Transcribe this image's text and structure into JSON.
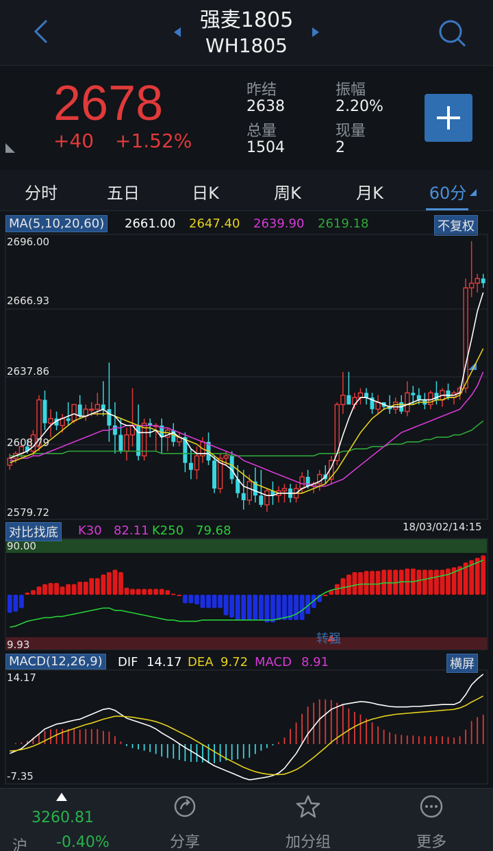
{
  "header": {
    "name": "强麦1805",
    "code": "WH1805"
  },
  "quote": {
    "price": "2678",
    "change": "+40",
    "change_pct": "+1.52%",
    "stats": [
      {
        "label": "昨结",
        "value": "2638"
      },
      {
        "label": "振幅",
        "value": "2.20%"
      },
      {
        "label": "总量",
        "value": "1504"
      },
      {
        "label": "现量",
        "value": "2"
      }
    ]
  },
  "tabs": [
    {
      "label": "分时"
    },
    {
      "label": "五日"
    },
    {
      "label": "日K"
    },
    {
      "label": "周K"
    },
    {
      "label": "月K"
    },
    {
      "label": "60分"
    }
  ],
  "ma": {
    "label": "MA(5,10,20,60)",
    "v5": "2661.00",
    "v10": "2647.40",
    "v20": "2639.90",
    "v60": "2619.18",
    "adjust": "不复权"
  },
  "k_axis": {
    "ticks": [
      "2696.00",
      "2666.93",
      "2637.86",
      "2608.79",
      "2579.72"
    ]
  },
  "bottom_ind": {
    "label": "对比找底",
    "k30_label": "K30",
    "k30": "82.11",
    "k250_label": "K250",
    "k250": "79.68",
    "datetime": "18/03/02/14:15",
    "top": "90.00",
    "bottom": "9.93",
    "annot": "转强"
  },
  "macd": {
    "label": "MACD(12,26,9)",
    "dif_label": "DIF",
    "dif": "14.17",
    "dea_label": "DEA",
    "dea": "9.72",
    "macd_label": "MACD",
    "macd": "8.91",
    "landscape": "横屏",
    "max": "14.17",
    "min": "-7.35"
  },
  "bottom_bar": {
    "index_value": "3260.81",
    "index_name": "沪",
    "index_pct": "-0.40%",
    "share": "分享",
    "watch": "加分组",
    "more": "更多"
  },
  "colors": {
    "up": "#e03a3a",
    "down": "#3ad6e0",
    "ma5": "#ffffff",
    "ma10": "#e6d21e",
    "ma20": "#d63ad6",
    "ma60": "#2fa83a",
    "accent": "#4a90d9"
  },
  "chart_data": [
    {
      "type": "candlestick",
      "ylim": [
        2579.72,
        2696.0
      ],
      "candles": [
        [
          2600,
          2605,
          2598,
          2603
        ],
        [
          2603,
          2606,
          2601,
          2605
        ],
        [
          2605,
          2609,
          2603,
          2608
        ],
        [
          2608,
          2611,
          2605,
          2606
        ],
        [
          2606,
          2615,
          2604,
          2613
        ],
        [
          2608,
          2630,
          2606,
          2628
        ],
        [
          2628,
          2632,
          2615,
          2618
        ],
        [
          2618,
          2624,
          2612,
          2620
        ],
        [
          2620,
          2623,
          2615,
          2617
        ],
        [
          2617,
          2622,
          2614,
          2620
        ],
        [
          2620,
          2627,
          2617,
          2619
        ],
        [
          2619,
          2626,
          2618,
          2626
        ],
        [
          2626,
          2630,
          2620,
          2621
        ],
        [
          2621,
          2626,
          2619,
          2624
        ],
        [
          2624,
          2627,
          2621,
          2624
        ],
        [
          2624,
          2631,
          2621,
          2626
        ],
        [
          2626,
          2636,
          2621,
          2624
        ],
        [
          2624,
          2644,
          2610,
          2617
        ],
        [
          2617,
          2627,
          2605,
          2613
        ],
        [
          2613,
          2620,
          2605,
          2606
        ],
        [
          2606,
          2616,
          2602,
          2613
        ],
        [
          2613,
          2633,
          2608,
          2617
        ],
        [
          2617,
          2626,
          2602,
          2604
        ],
        [
          2604,
          2620,
          2602,
          2618
        ],
        [
          2618,
          2620,
          2612,
          2617
        ],
        [
          2617,
          2618,
          2606,
          2617
        ],
        [
          2617,
          2620,
          2605,
          2612
        ],
        [
          2612,
          2616,
          2606,
          2615
        ],
        [
          2615,
          2618,
          2608,
          2610
        ],
        [
          2610,
          2614,
          2608,
          2612
        ],
        [
          2612,
          2614,
          2597,
          2601
        ],
        [
          2601,
          2607,
          2594,
          2598
        ],
        [
          2598,
          2608,
          2594,
          2604
        ],
        [
          2604,
          2612,
          2601,
          2610
        ],
        [
          2610,
          2614,
          2600,
          2602
        ],
        [
          2602,
          2604,
          2588,
          2590
        ],
        [
          2590,
          2605,
          2588,
          2603
        ],
        [
          2603,
          2606,
          2600,
          2604
        ],
        [
          2604,
          2606,
          2592,
          2594
        ],
        [
          2594,
          2600,
          2586,
          2588
        ],
        [
          2588,
          2598,
          2581,
          2585
        ],
        [
          2585,
          2596,
          2583,
          2593
        ],
        [
          2593,
          2599,
          2584,
          2587
        ],
        [
          2587,
          2598,
          2582,
          2583
        ],
        [
          2583,
          2590,
          2580,
          2589
        ],
        [
          2589,
          2593,
          2583,
          2587
        ],
        [
          2587,
          2591,
          2584,
          2589
        ],
        [
          2589,
          2592,
          2584,
          2590
        ],
        [
          2590,
          2592,
          2584,
          2586
        ],
        [
          2586,
          2592,
          2584,
          2590
        ],
        [
          2590,
          2597,
          2588,
          2595
        ],
        [
          2595,
          2598,
          2590,
          2591
        ],
        [
          2591,
          2593,
          2588,
          2592
        ],
        [
          2592,
          2598,
          2589,
          2596
        ],
        [
          2596,
          2600,
          2592,
          2594
        ],
        [
          2594,
          2604,
          2592,
          2602
        ],
        [
          2602,
          2627,
          2600,
          2626
        ],
        [
          2626,
          2640,
          2622,
          2630
        ],
        [
          2630,
          2640,
          2628,
          2626
        ],
        [
          2626,
          2631,
          2624,
          2629
        ],
        [
          2629,
          2633,
          2626,
          2631
        ],
        [
          2631,
          2633,
          2626,
          2629
        ],
        [
          2629,
          2631,
          2622,
          2624
        ],
        [
          2624,
          2630,
          2622,
          2627
        ],
        [
          2627,
          2627,
          2624,
          2625
        ],
        [
          2625,
          2630,
          2622,
          2624
        ],
        [
          2624,
          2629,
          2622,
          2627
        ],
        [
          2627,
          2630,
          2622,
          2623
        ],
        [
          2623,
          2636,
          2621,
          2631
        ],
        [
          2631,
          2634,
          2626,
          2630
        ],
        [
          2630,
          2633,
          2626,
          2628
        ],
        [
          2628,
          2631,
          2624,
          2626
        ],
        [
          2626,
          2632,
          2624,
          2631
        ],
        [
          2631,
          2636,
          2626,
          2628
        ],
        [
          2628,
          2633,
          2625,
          2632
        ],
        [
          2632,
          2635,
          2628,
          2629
        ],
        [
          2629,
          2632,
          2626,
          2631
        ],
        [
          2631,
          2634,
          2628,
          2633
        ],
        [
          2633,
          2680,
          2631,
          2676
        ],
        [
          2676,
          2696,
          2672,
          2678
        ],
        [
          2678,
          2682,
          2674,
          2680
        ],
        [
          2680,
          2682,
          2676,
          2678
        ]
      ],
      "ma5": [
        2603,
        2604,
        2605,
        2606,
        2608,
        2611,
        2614,
        2617,
        2619,
        2620,
        2621,
        2622,
        2621,
        2621,
        2622,
        2623,
        2624,
        2622,
        2621,
        2618,
        2617,
        2617,
        2614,
        2614,
        2614,
        2615,
        2612,
        2613,
        2614,
        2612,
        2611,
        2607,
        2605,
        2605,
        2605,
        2603,
        2601,
        2600,
        2598,
        2594,
        2591,
        2590,
        2589,
        2588,
        2587,
        2587,
        2588,
        2588,
        2588,
        2588,
        2590,
        2591,
        2592,
        2593,
        2595,
        2599,
        2605,
        2613,
        2620,
        2626,
        2629,
        2629,
        2628,
        2627,
        2626,
        2625,
        2625,
        2625,
        2626,
        2627,
        2628,
        2628,
        2628,
        2629,
        2630,
        2630,
        2630,
        2631,
        2643,
        2654,
        2666,
        2674
      ],
      "ma10": [
        2601,
        2602,
        2603,
        2604,
        2605,
        2607,
        2609,
        2611,
        2613,
        2615,
        2617,
        2619,
        2620,
        2621,
        2622,
        2622,
        2622,
        2622,
        2621,
        2620,
        2619,
        2618,
        2617,
        2616,
        2616,
        2615,
        2614,
        2614,
        2613,
        2612,
        2611,
        2610,
        2609,
        2607,
        2606,
        2604,
        2602,
        2601,
        2600,
        2598,
        2596,
        2594,
        2592,
        2591,
        2590,
        2589,
        2588,
        2588,
        2588,
        2588,
        2588,
        2589,
        2590,
        2591,
        2592,
        2595,
        2598,
        2602,
        2606,
        2610,
        2614,
        2617,
        2620,
        2622,
        2624,
        2625,
        2626,
        2626,
        2626,
        2626,
        2627,
        2627,
        2627,
        2628,
        2628,
        2629,
        2629,
        2630,
        2635,
        2640,
        2645,
        2650
      ],
      "ma20": [
        2602,
        2602,
        2603,
        2603,
        2604,
        2604,
        2605,
        2606,
        2607,
        2608,
        2609,
        2610,
        2611,
        2612,
        2613,
        2614,
        2615,
        2615,
        2616,
        2616,
        2617,
        2617,
        2617,
        2617,
        2617,
        2617,
        2616,
        2616,
        2615,
        2614,
        2613,
        2612,
        2611,
        2610,
        2609,
        2608,
        2607,
        2606,
        2605,
        2604,
        2602,
        2601,
        2600,
        2599,
        2598,
        2597,
        2596,
        2595,
        2594,
        2593,
        2592,
        2592,
        2591,
        2591,
        2591,
        2592,
        2593,
        2594,
        2596,
        2598,
        2600,
        2602,
        2604,
        2606,
        2608,
        2610,
        2612,
        2614,
        2615,
        2616,
        2617,
        2618,
        2619,
        2620,
        2621,
        2622,
        2623,
        2624,
        2627,
        2630,
        2634,
        2640
      ],
      "ma60": [
        2604,
        2604,
        2604,
        2604,
        2605,
        2605,
        2605,
        2605,
        2605,
        2605,
        2606,
        2606,
        2606,
        2606,
        2606,
        2606,
        2606,
        2606,
        2606,
        2606,
        2606,
        2606,
        2606,
        2606,
        2606,
        2606,
        2605,
        2605,
        2605,
        2605,
        2605,
        2605,
        2605,
        2605,
        2605,
        2605,
        2605,
        2605,
        2604,
        2604,
        2604,
        2604,
        2604,
        2604,
        2604,
        2604,
        2604,
        2604,
        2604,
        2604,
        2604,
        2604,
        2604,
        2605,
        2605,
        2605,
        2605,
        2606,
        2606,
        2607,
        2607,
        2607,
        2608,
        2608,
        2608,
        2609,
        2609,
        2609,
        2610,
        2610,
        2610,
        2611,
        2611,
        2612,
        2612,
        2612,
        2613,
        2613,
        2614,
        2615,
        2617,
        2619
      ]
    },
    {
      "type": "bar",
      "ylim": [
        9.93,
        90.0
      ],
      "values": [
        36,
        37,
        40,
        53,
        55,
        58,
        60,
        61,
        61,
        58,
        60,
        60,
        62,
        62,
        65,
        65,
        68,
        70,
        72,
        70,
        57,
        56,
        56,
        56,
        56,
        56,
        56,
        55,
        52,
        50,
        44,
        44,
        43,
        40,
        40,
        40,
        40,
        34,
        32,
        30,
        30,
        30,
        30,
        30,
        28,
        28,
        30,
        30,
        30,
        30,
        30,
        35,
        40,
        45,
        50,
        55,
        60,
        65,
        68,
        70,
        70,
        71,
        71,
        71,
        72,
        72,
        72,
        72,
        73,
        73,
        72,
        72,
        72,
        72,
        72,
        73,
        74,
        75,
        78,
        80,
        82,
        84
      ],
      "k250": [
        24,
        25,
        27,
        29,
        30,
        31,
        32,
        32,
        33,
        33,
        34,
        35,
        36,
        37,
        38,
        39,
        40,
        40,
        38,
        38,
        37,
        36,
        35,
        34,
        33,
        32,
        31,
        30,
        30,
        29,
        29,
        29,
        29,
        30,
        30,
        30,
        30,
        30,
        30,
        30,
        30,
        30,
        30,
        30,
        30,
        30,
        31,
        32,
        33,
        35,
        38,
        42,
        46,
        50,
        53,
        55,
        56,
        57,
        58,
        59,
        60,
        60,
        60,
        60,
        61,
        61,
        61,
        62,
        62,
        62,
        63,
        64,
        65,
        66,
        67,
        68,
        70,
        72,
        74,
        76,
        78,
        80
      ]
    },
    {
      "type": "line",
      "ylim": [
        -7.35,
        14.17
      ],
      "dif": [
        -2,
        -1.5,
        -1,
        0,
        1,
        2,
        3,
        3.5,
        4,
        4.2,
        4.5,
        4.8,
        5,
        5.5,
        6,
        6.5,
        7,
        7.2,
        6.8,
        6,
        5.2,
        4.8,
        4.4,
        4,
        3.6,
        3,
        2.2,
        1.5,
        0.8,
        0,
        -0.8,
        -1.5,
        -2.2,
        -3,
        -3.8,
        -4.5,
        -5,
        -5.5,
        -6,
        -6.5,
        -7,
        -7.35,
        -7.2,
        -7,
        -6.8,
        -6.5,
        -6,
        -5,
        -3.5,
        -2,
        0,
        2,
        3.5,
        5,
        6,
        7,
        7.5,
        8,
        8.2,
        8.4,
        8.6,
        8.5,
        8.3,
        8,
        7.8,
        7.6,
        7.5,
        7.5,
        7.5,
        7.6,
        7.6,
        7.7,
        7.8,
        7.9,
        8,
        8,
        8,
        8.5,
        10,
        12,
        13.2,
        14.17
      ],
      "dea": [
        -1.5,
        -1.4,
        -1.2,
        -0.9,
        -0.5,
        0,
        0.6,
        1.2,
        1.8,
        2.3,
        2.7,
        3.1,
        3.5,
        3.9,
        4.2,
        4.6,
        5,
        5.3,
        5.6,
        5.6,
        5.5,
        5.4,
        5.2,
        5,
        4.8,
        4.5,
        4.1,
        3.6,
        3,
        2.4,
        1.8,
        1.2,
        0.5,
        -0.2,
        -0.9,
        -1.6,
        -2.3,
        -3,
        -3.6,
        -4.2,
        -4.8,
        -5.3,
        -5.7,
        -6,
        -6.2,
        -6.3,
        -6.3,
        -6.2,
        -5.8,
        -5.3,
        -4.6,
        -3.7,
        -2.8,
        -1.8,
        -0.8,
        0.3,
        1.2,
        2,
        2.8,
        3.5,
        4.1,
        4.6,
        5,
        5.3,
        5.6,
        5.8,
        6,
        6.1,
        6.2,
        6.3,
        6.4,
        6.5,
        6.6,
        6.7,
        6.8,
        6.9,
        7,
        7.3,
        7.8,
        8.5,
        9.1,
        9.72
      ],
      "macd": [
        0,
        0.3,
        0.5,
        1,
        2,
        3,
        4,
        4.5,
        4.6,
        4.6,
        4.6,
        4.6,
        4.4,
        4.6,
        4.6,
        4.6,
        4,
        3.8,
        2.4,
        0.8,
        -0.6,
        -1.2,
        -1.6,
        -2,
        -2.4,
        -3,
        -3.8,
        -4.2,
        -4.4,
        -4.8,
        -5.2,
        -5.4,
        -5.4,
        -5.6,
        -5.8,
        -5.8,
        -5.4,
        -5,
        -4.8,
        -4.6,
        -4.4,
        -4.1,
        -3,
        -2,
        -1.2,
        -0.4,
        0.6,
        2,
        4.6,
        6.6,
        9.2,
        11.4,
        12.6,
        13.6,
        13.6,
        13.4,
        12.6,
        12,
        10.8,
        9.8,
        9,
        7.8,
        6.6,
        5.4,
        4.4,
        3.6,
        3,
        2.8,
        2.6,
        2.6,
        2.4,
        2.4,
        2.4,
        2.4,
        2.4,
        2.2,
        2,
        2.4,
        4.4,
        7,
        8.2,
        8.91
      ]
    }
  ]
}
